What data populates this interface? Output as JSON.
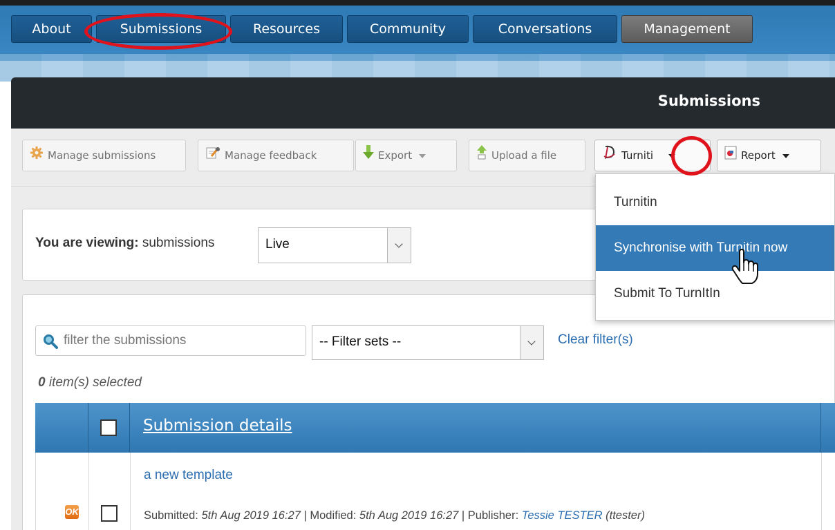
{
  "nav": {
    "tabs": [
      {
        "label": "About"
      },
      {
        "label": "Submissions"
      },
      {
        "label": "Resources"
      },
      {
        "label": "Community"
      },
      {
        "label": "Conversations"
      },
      {
        "label": "Management"
      }
    ]
  },
  "panel": {
    "title": "Submissions"
  },
  "toolbar": {
    "manage_submissions": "Manage submissions",
    "manage_feedback": "Manage feedback",
    "export": "Export",
    "upload": "Upload a file",
    "turnitin": "Turniti",
    "report": "Report"
  },
  "turnitin_menu": {
    "items": [
      {
        "label": "Turnitin"
      },
      {
        "label": "Synchronise with Turnitin now"
      },
      {
        "label": "Submit To TurnItIn"
      }
    ]
  },
  "view": {
    "label_bold": "You are viewing:",
    "label_rest": " submissions",
    "selected": "Live"
  },
  "filters": {
    "search_placeholder": "filter the submissions",
    "filter_sets": "-- Filter sets --",
    "clear": "Clear filter(s)",
    "selected_count": "0",
    "selected_suffix": " item(s) selected"
  },
  "table": {
    "header": "Submission details",
    "rows": [
      {
        "badge": "OK",
        "title": "a new template",
        "submitted_label": "Submitted: ",
        "submitted": "5th Aug 2019 16:27",
        "modified_label": " | Modified: ",
        "modified": "5th Aug 2019 16:27",
        "publisher_label": " | Publisher: ",
        "publisher": "Tessie TESTER",
        "username": " (ttester)"
      }
    ]
  },
  "colors": {
    "annotation": "#e0121b",
    "hover": "#337ab7",
    "link": "#2a6db0"
  }
}
